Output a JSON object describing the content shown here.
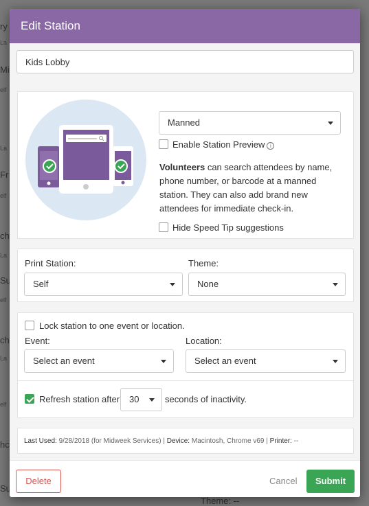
{
  "background": {
    "fragments": [
      "ry",
      "La",
      "Mi",
      "elf",
      "La",
      "Fr",
      "elf",
      "ch",
      "La",
      "Su",
      "elf",
      "ch",
      "La",
      "elf",
      "hc",
      "Su",
      "Theme: --"
    ]
  },
  "modal": {
    "title": "Edit Station",
    "station_name": "Kids Lobby",
    "mode": {
      "selected": "Manned",
      "enable_preview_label": "Enable Station Preview",
      "enable_preview_checked": false,
      "description_bold": "Volunteers",
      "description_rest": " can search attendees by name, phone number, or barcode at a manned station. They can also add brand new attendees for immediate check-in.",
      "hide_tips_label": "Hide Speed Tip suggestions",
      "hide_tips_checked": false
    },
    "print": {
      "print_station_label": "Print Station:",
      "print_station_value": "Self",
      "theme_label": "Theme:",
      "theme_value": "None"
    },
    "lock": {
      "lock_label": "Lock station to one event or location.",
      "lock_checked": false,
      "event_label": "Event:",
      "event_value": "Select an event",
      "location_label": "Location:",
      "location_value": "Select an event"
    },
    "refresh": {
      "checked": true,
      "prefix": "Refresh station after",
      "seconds": "30",
      "suffix": "seconds of inactivity."
    },
    "meta": {
      "last_used_label": "Last Used:",
      "last_used_value": "9/28/2018 (for Midweek Services)",
      "device_label": "Device:",
      "device_value": "Macintosh, Chrome v69",
      "printer_label": "Printer:",
      "printer_value": "--",
      "separator": "|"
    },
    "footer": {
      "delete_label": "Delete",
      "cancel_label": "Cancel",
      "submit_label": "Submit"
    }
  },
  "colors": {
    "header": "#8a67a5",
    "illustration_circle": "#dbe8f3",
    "device_purple": "#7b5a9c",
    "success_green": "#3aa655",
    "danger_red": "#d9534f"
  }
}
